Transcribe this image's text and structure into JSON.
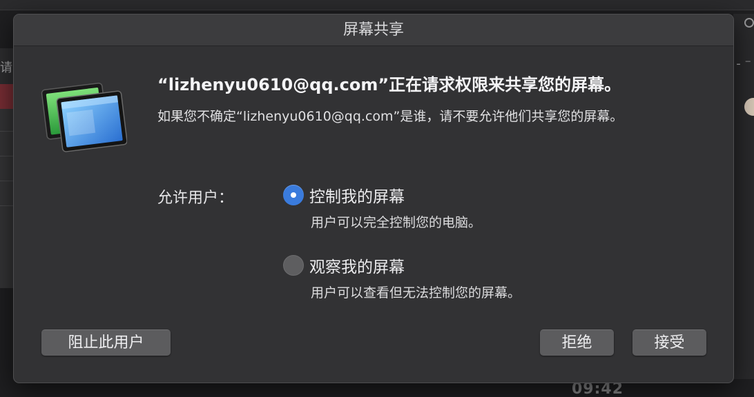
{
  "background": {
    "left_fragment": "请申",
    "right_fragment": "- ⁻",
    "time": "09:42"
  },
  "dialog": {
    "title": "屏幕共享",
    "headline": "“lizhenyu0610@qq.com”正在请求权限来共享您的屏幕。",
    "subline": "如果您不确定“lizhenyu0610@qq.com”是谁，请不要允许他们共享您的屏幕。",
    "allow_label": "允许用户：",
    "options": [
      {
        "label": "控制我的屏幕",
        "description": "用户可以完全控制您的电脑。",
        "selected": true
      },
      {
        "label": "观察我的屏幕",
        "description": "用户可以查看但无法控制您的屏幕。",
        "selected": false
      }
    ],
    "buttons": {
      "block": "阻止此用户",
      "reject": "拒绝",
      "accept": "接受"
    }
  },
  "colors": {
    "radio_selected": "#3a7bdc",
    "dialog_background": "#323234"
  },
  "icons": {
    "app_icon": "screen-sharing-icon",
    "selected_radio": "radio-selected-icon",
    "unselected_radio": "radio-unselected-icon"
  }
}
